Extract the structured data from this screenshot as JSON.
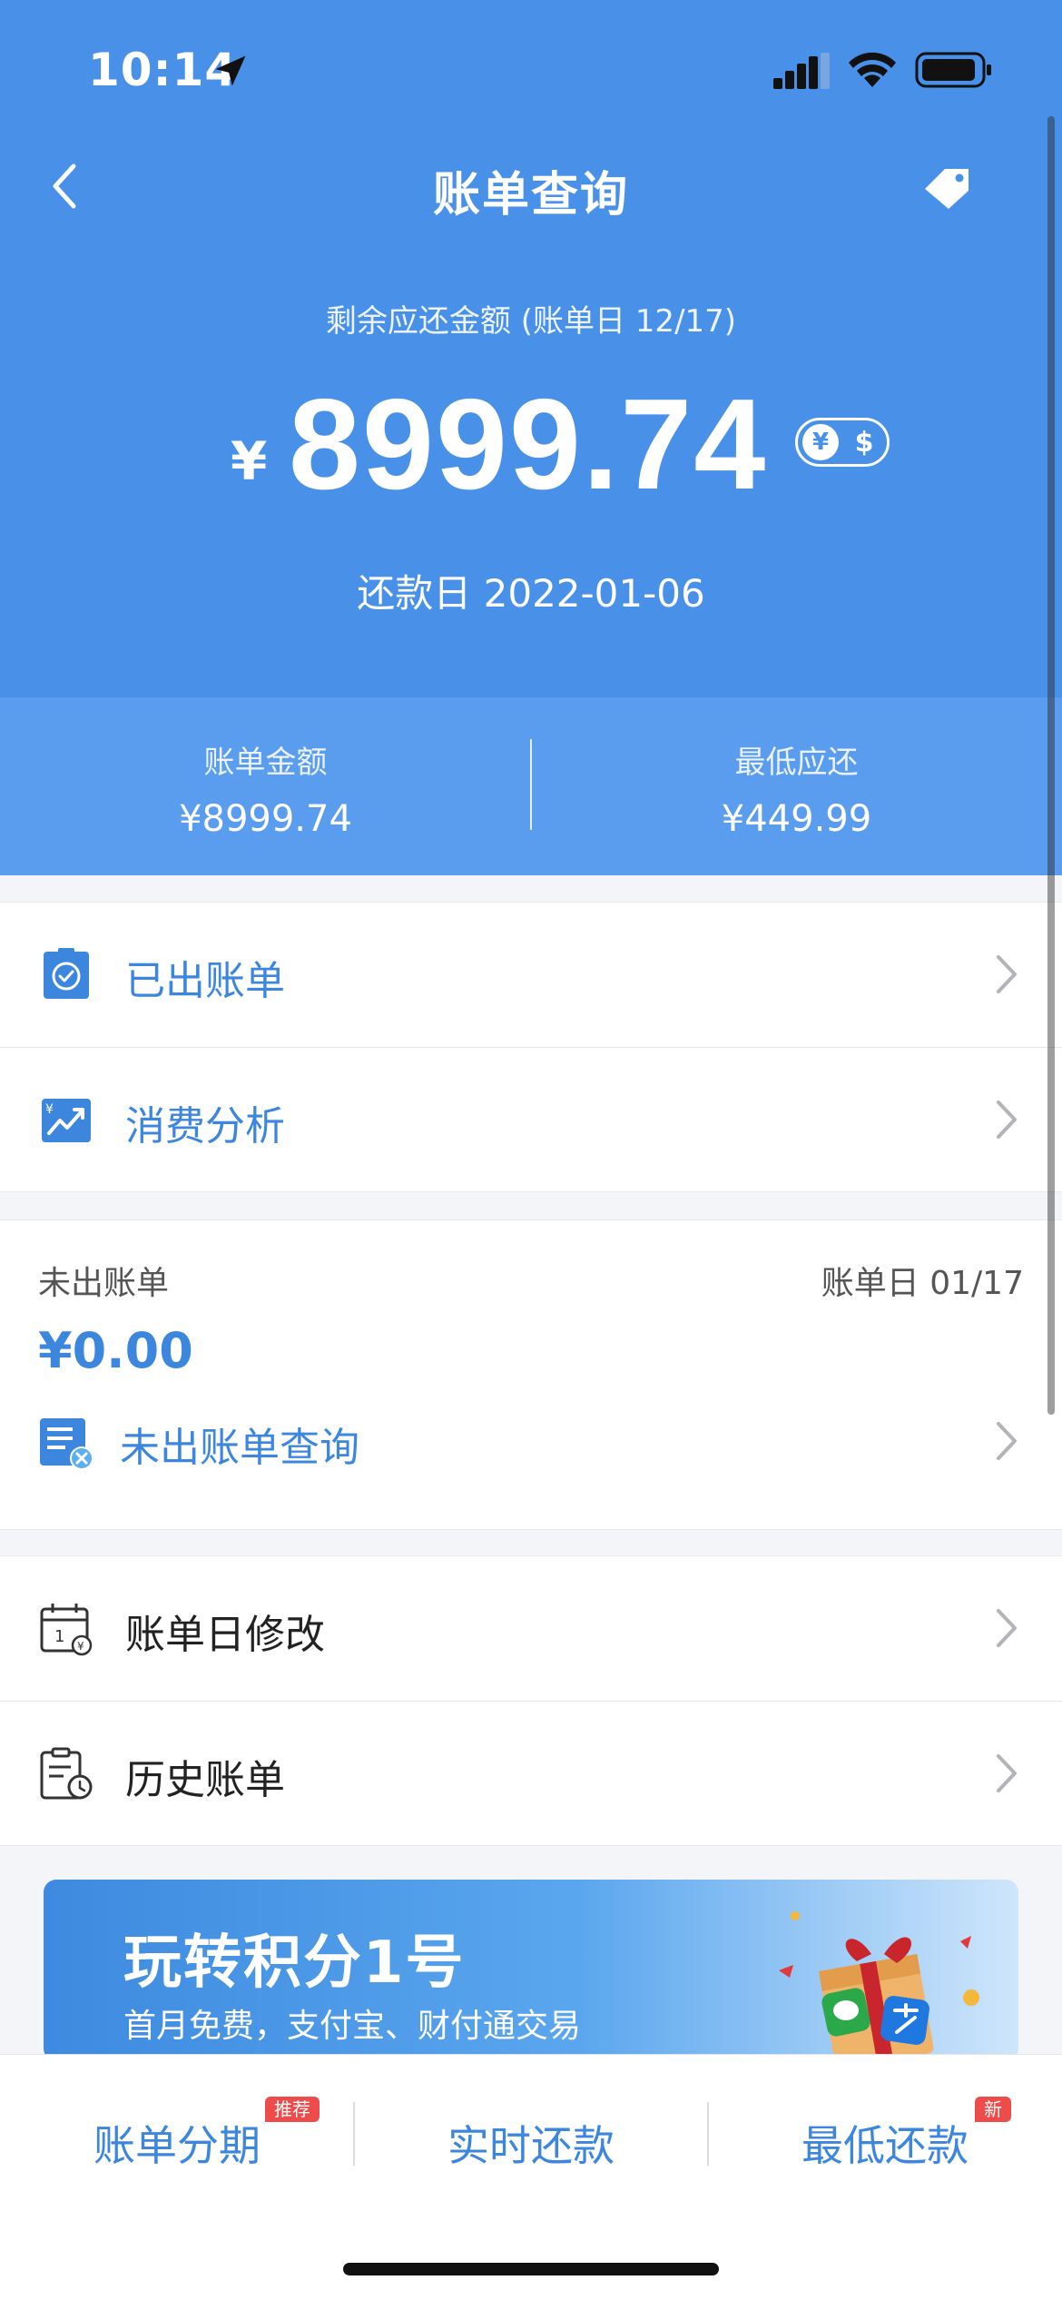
{
  "status_bar": {
    "time": "10:14"
  },
  "header": {
    "title": "账单查询"
  },
  "statement": {
    "remaining_label": "剩余应还金额 (账单日 12/17)",
    "currency_symbol": "¥",
    "remaining_amount": "8999.74",
    "toggle_yen": "¥",
    "toggle_dollar": "$",
    "due_date": "还款日 2022-01-06"
  },
  "summary": {
    "bill_label": "账单金额",
    "bill_value": "¥8999.74",
    "min_label": "最低应还",
    "min_value": "¥449.99"
  },
  "menu": [
    {
      "label": "已出账单",
      "icon": "issued-bill-icon"
    },
    {
      "label": "消费分析",
      "icon": "spending-analysis-icon"
    }
  ],
  "unbilled": {
    "label": "未出账单",
    "bill_date": "账单日 01/17",
    "amount": "¥0.00",
    "query_label": "未出账单查询"
  },
  "settings": [
    {
      "label": "账单日修改",
      "icon": "calendar-icon"
    },
    {
      "label": "历史账单",
      "icon": "history-icon"
    }
  ],
  "banner": {
    "title": "玩转积分1号",
    "subtitle": "首月免费，支付宝、财付通交易"
  },
  "tabbar": {
    "installment": "账单分期",
    "installment_badge": "推荐",
    "realtime": "实时还款",
    "minimum": "最低还款",
    "minimum_badge": "新"
  },
  "colors": {
    "primary": "#4890e8",
    "link": "#3c86de",
    "badge": "#ee4c4a"
  }
}
